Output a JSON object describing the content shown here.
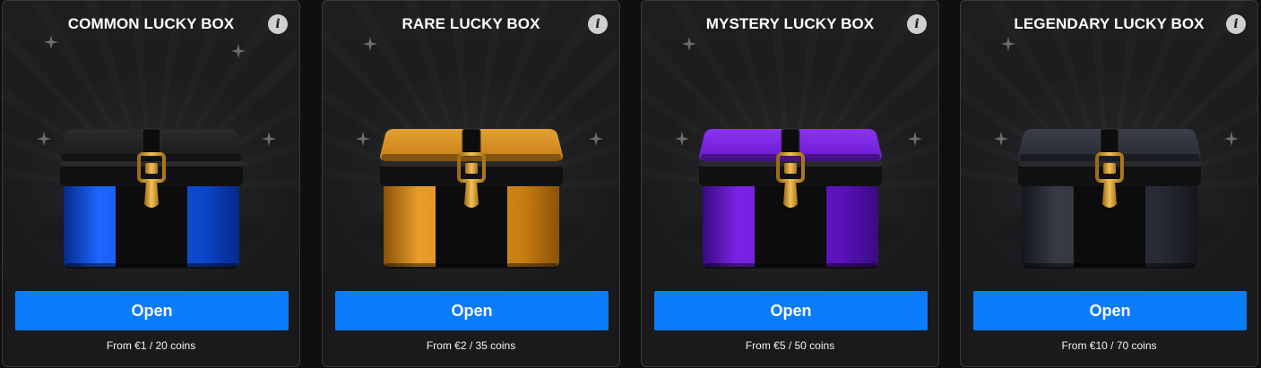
{
  "boxes": [
    {
      "title": "COMMON LUCKY BOX",
      "button_label": "Open",
      "price_text": "From €1 / 20 coins",
      "info_icon": "info-icon",
      "color": "#0b46c8",
      "color_light": "#1e66ff",
      "color_dark": "#06298a",
      "lid_color": "#1a1a1c",
      "lid_top": "#2b2b2e",
      "latch": "gold"
    },
    {
      "title": "RARE LUCKY BOX",
      "button_label": "Open",
      "price_text": "From €2 / 35 coins",
      "info_icon": "info-icon",
      "color": "#c67d12",
      "color_light": "#e89d2c",
      "color_dark": "#8a5208",
      "lid_color": "#c67d12",
      "lid_top": "#e3a035",
      "latch": "gold"
    },
    {
      "title": "MYSTERY LUCKY BOX",
      "button_label": "Open",
      "price_text": "From €5 / 50 coins",
      "info_icon": "info-icon",
      "color": "#5a12b8",
      "color_light": "#7a24e6",
      "color_dark": "#3a0a80",
      "lid_color": "#6a18d0",
      "lid_top": "#8a34f0",
      "latch": "gold"
    },
    {
      "title": "LEGENDARY LUCKY BOX",
      "button_label": "Open",
      "price_text": "From €10 / 70 coins",
      "info_icon": "info-icon",
      "color": "#262a33",
      "color_light": "#363b46",
      "color_dark": "#15171c",
      "lid_color": "#262a33",
      "lid_top": "#3a3f4a",
      "latch": "gold"
    }
  ],
  "accent": "#0a7bfb"
}
